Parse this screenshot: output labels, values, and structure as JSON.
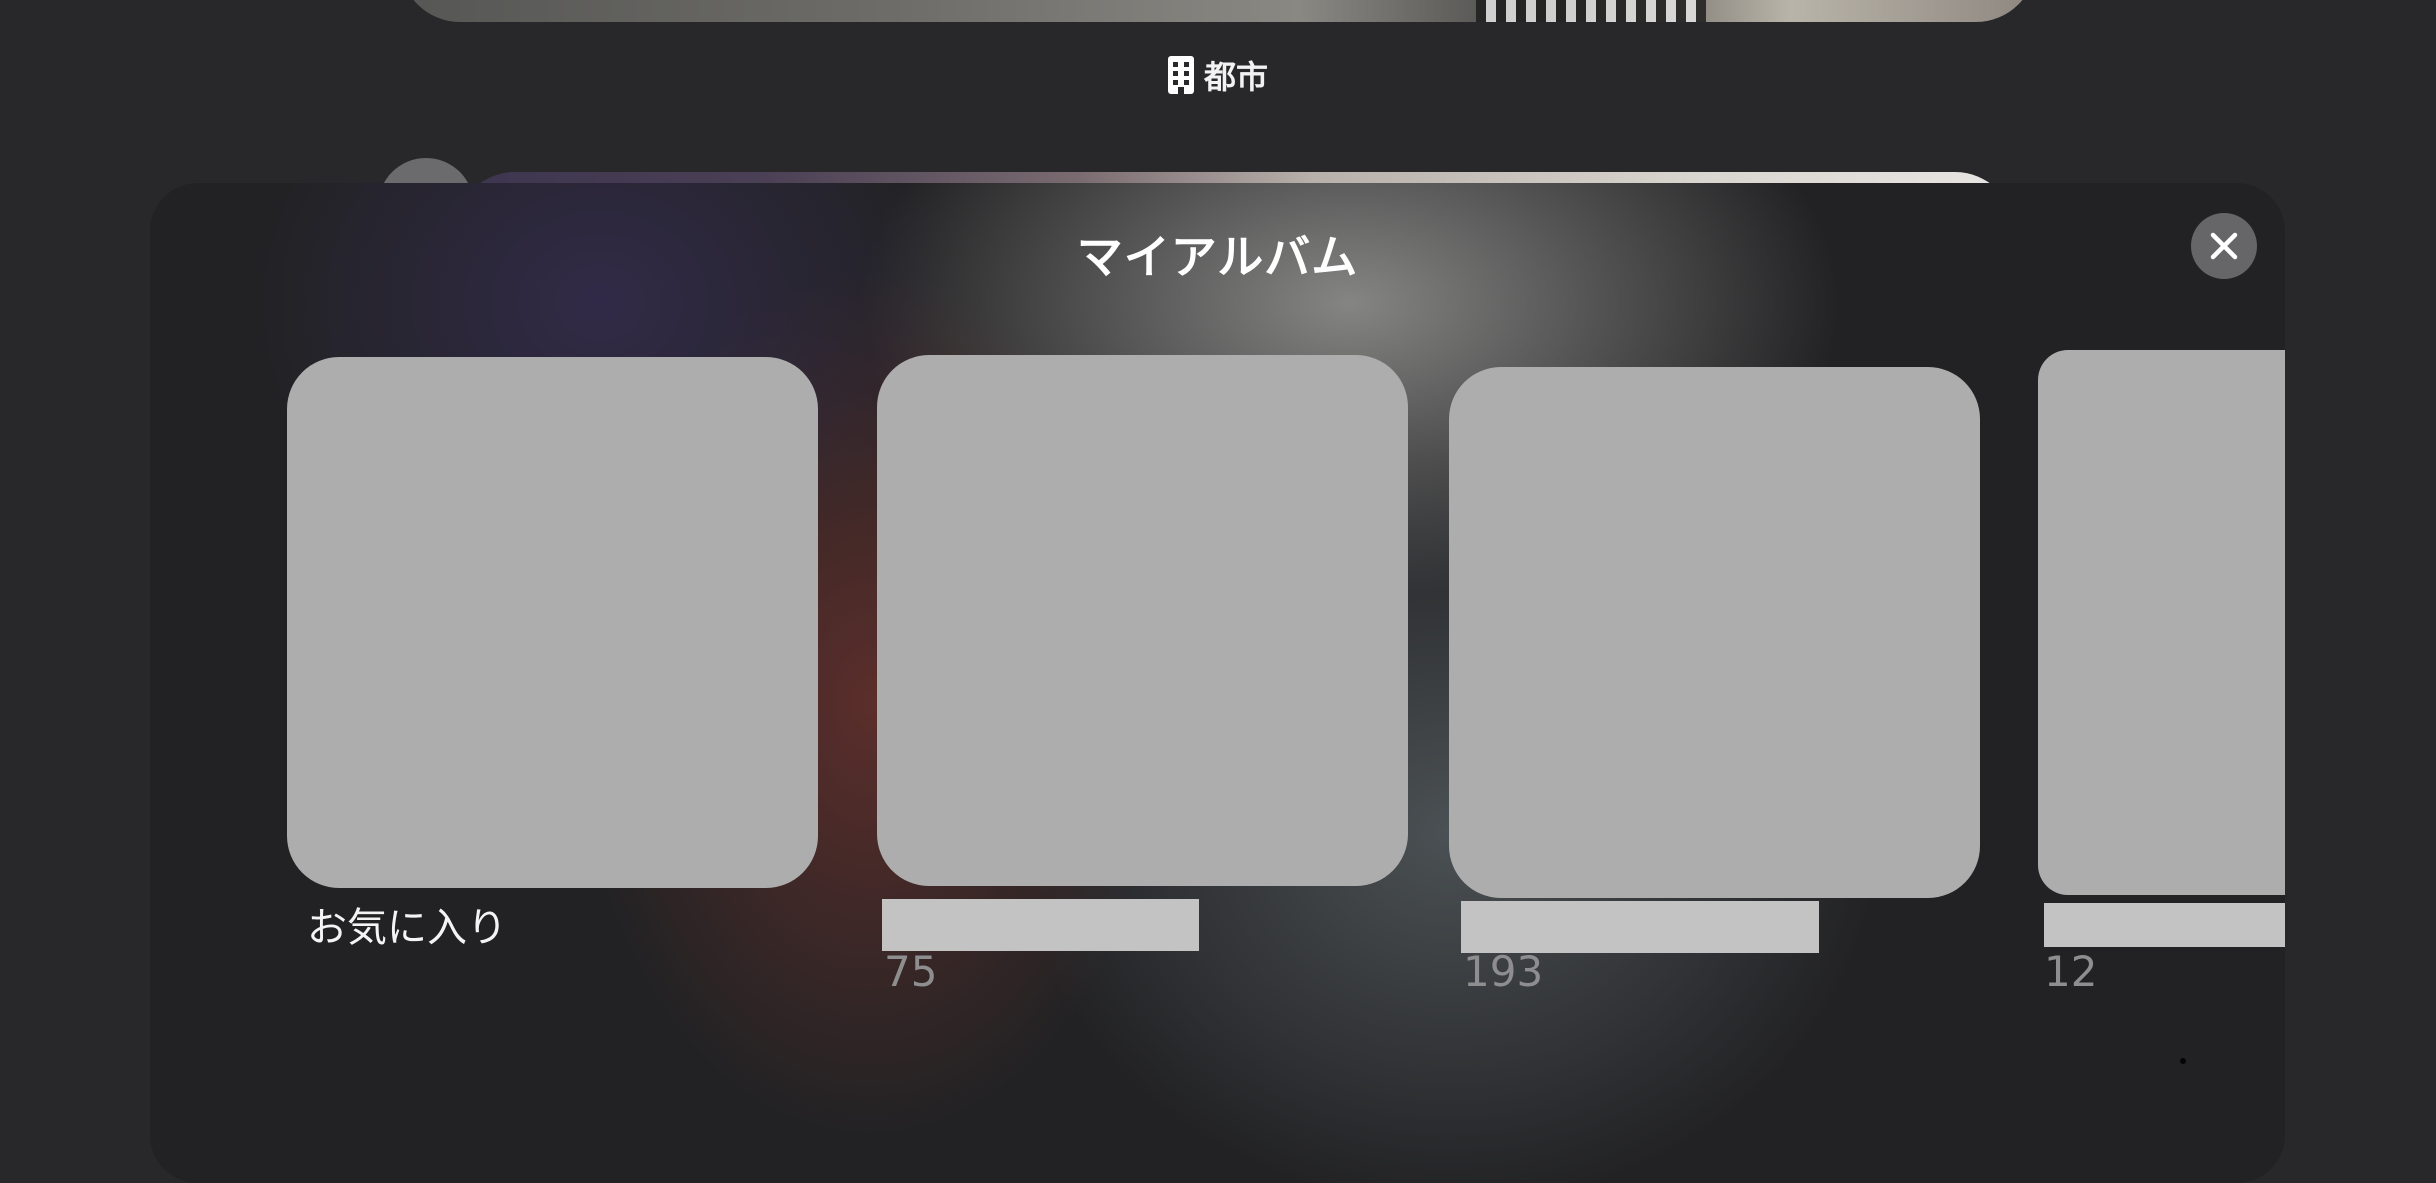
{
  "background": {
    "caption": "都市",
    "caption_icon": "building-icon"
  },
  "sheet": {
    "title": "マイアルバム",
    "close_icon": "close-icon",
    "albums": [
      {
        "name": "お気に入り",
        "count": ""
      },
      {
        "name": "",
        "count": "75"
      },
      {
        "name": "",
        "count": "193"
      },
      {
        "name": "",
        "count": "12"
      }
    ]
  },
  "colors": {
    "background": "#28282b",
    "placeholder_thumb": "#adadad",
    "redaction": "#c3c3c3",
    "count_text": "#8e8e90"
  }
}
